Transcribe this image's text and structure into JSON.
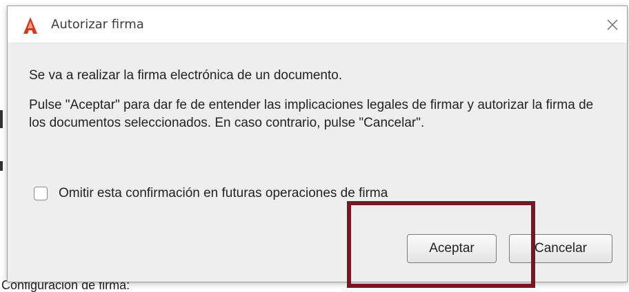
{
  "background": {
    "partial_text": "Configuración de firma:"
  },
  "dialog": {
    "title": "Autorizar firma",
    "app_icon": "autofirma-logo-icon",
    "close_icon": "close-icon",
    "message_line1": "Se va a realizar la firma electrónica de un documento.",
    "message_line2": "Pulse \"Aceptar\" para dar fe de entender las implicaciones legales de firmar y autorizar la firma de los documentos seleccionados. En caso contrario, pulse \"Cancelar\".",
    "checkbox": {
      "label": "Omitir esta confirmación en futuras operaciones de firma",
      "checked": false
    },
    "buttons": {
      "accept": "Aceptar",
      "cancel": "Cancelar"
    }
  },
  "annotation": {
    "highlight_color": "#7a1624"
  }
}
